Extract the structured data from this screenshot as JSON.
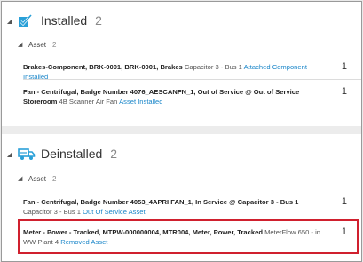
{
  "sections": [
    {
      "title": "Installed",
      "count": "2",
      "group": {
        "label": "Asset",
        "count": "2"
      },
      "items": [
        {
          "name": "Brakes-Component, BRK-0001, BRK-0001, Brakes",
          "location": "Capacitor 3 - Bus 1",
          "status": "Attached Component Installed",
          "quantity": "1"
        },
        {
          "name": "Fan - Centrifugal, Badge Number 4076_AESCANFN_1, Out of Service @ Out of Service Storeroom",
          "location": "4B Scanner Air Fan",
          "status": "Asset Installed",
          "quantity": "1"
        }
      ]
    },
    {
      "title": "Deinstalled",
      "count": "2",
      "group": {
        "label": "Asset",
        "count": "2"
      },
      "items": [
        {
          "name": "Fan - Centrifugal, Badge Number 4053_4APRI FAN_1, In Service @ Capacitor 3 - Bus 1",
          "location": "Capacitor 3 - Bus 1",
          "status": "Out Of Service Asset",
          "quantity": "1"
        },
        {
          "name": "Meter - Power - Tracked, MTPW-000000004, MTR004, Meter, Power, Tracked",
          "location": "MeterFlow 650 - in WW Plant 4",
          "status": "Removed Asset",
          "quantity": "1"
        }
      ]
    }
  ],
  "colors": {
    "accent": "#1a86c9",
    "icon": "#2aa0d8",
    "highlight": "#d0202e"
  },
  "icons": {
    "installed": "check-box-icon",
    "deinstalled": "truck-icon",
    "expanded": "caret-down-icon"
  }
}
